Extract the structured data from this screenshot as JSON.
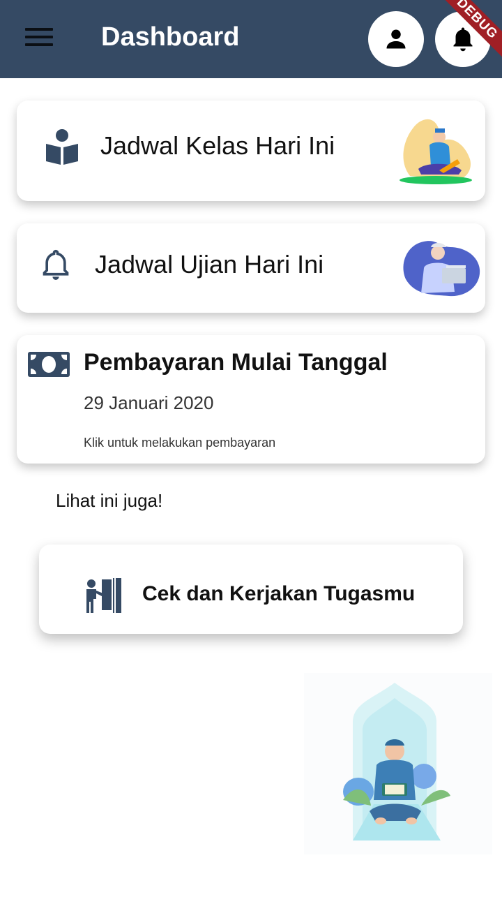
{
  "appbar": {
    "title": "Dashboard",
    "menu_icon": "hamburger-menu-icon",
    "profile_icon": "person-icon",
    "notification_icon": "bell-icon",
    "background": "#354a64",
    "debug_banner": "DEBUG"
  },
  "cards": {
    "class_schedule": {
      "label": "Jadwal Kelas Hari Ini",
      "icon": "book-reader-icon"
    },
    "exam_schedule": {
      "label": "Jadwal Ujian Hari Ini",
      "icon": "bell-outline-icon"
    },
    "payment": {
      "title": "Pembayaran Mulai Tanggal",
      "date": "29 Januari 2020",
      "hint": "Klik untuk melakukan pembayaran",
      "icon": "money-bill-icon"
    }
  },
  "see_also": "Lihat ini juga!",
  "task_card": {
    "label": "Cek dan Kerjakan Tugasmu",
    "icon": "person-at-door-icon"
  },
  "accent_color": "#354a64"
}
